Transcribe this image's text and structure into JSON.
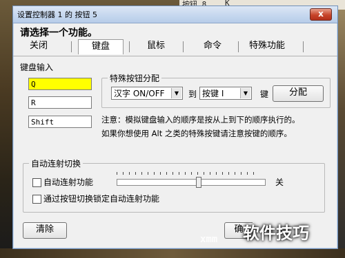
{
  "background": {
    "top_text_left": "按钮 8",
    "top_text_right": "K"
  },
  "window": {
    "title": "设置控制器 1 的 按钮 5",
    "close_label": "x",
    "heading": "请选择一个功能。"
  },
  "tabs": [
    {
      "label": "关闭",
      "selected": false
    },
    {
      "label": "键盘",
      "selected": true
    },
    {
      "label": "鼠标",
      "selected": false
    },
    {
      "label": "命令",
      "selected": false
    },
    {
      "label": "特殊功能",
      "selected": false
    }
  ],
  "keyboard_input": {
    "legend": "键盘输入",
    "keys": [
      "Q",
      "R",
      "Shift"
    ],
    "highlight_color": "#ffff00"
  },
  "special_assign": {
    "legend": "特殊按钮分配",
    "select1_value": "汉字 ON/OFF",
    "to_label": "到",
    "select2_value": "按键 I",
    "key_label": "键",
    "assign_button": "分配"
  },
  "notes": {
    "line1": "注意：模拟键盘输入的顺序是按从上到下的顺序执行的。",
    "line2": "如果你想使用 Alt 之类的特殊按键请注意按键的顺序。"
  },
  "autofire": {
    "legend": "自动连射切换",
    "checkbox1": "自动连射功能",
    "checkbox2": "通过按钮切换锁定自动连射功能",
    "slider_end_label": "关",
    "slider_value": 0.55
  },
  "footer": {
    "clear_button": "清除",
    "ok_button_partial": "确"
  },
  "watermark": {
    "text": "软件技巧",
    "url": "xmm"
  }
}
